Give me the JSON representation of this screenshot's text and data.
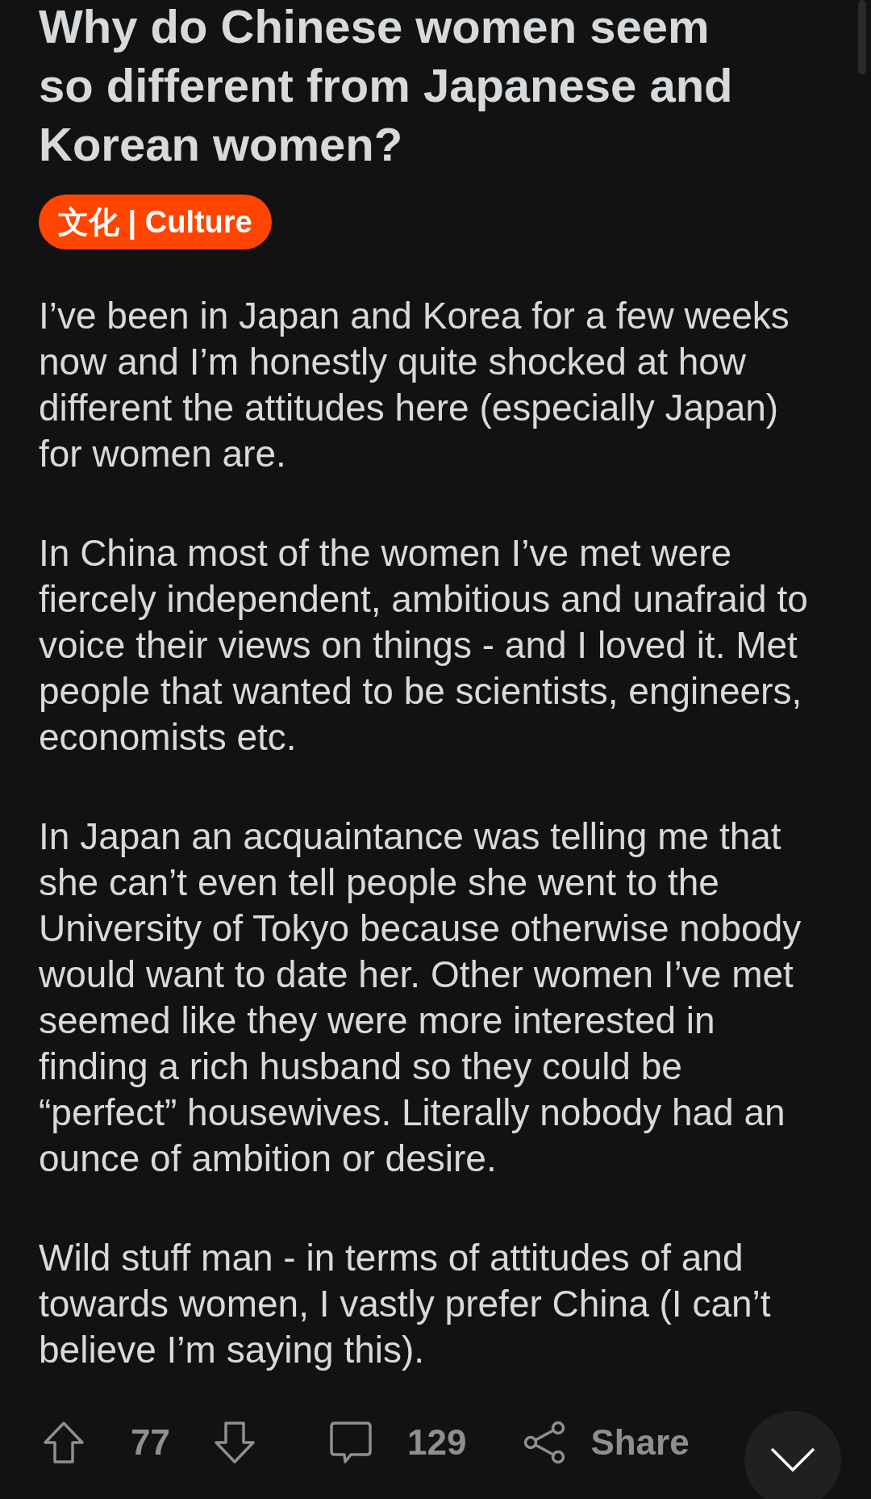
{
  "post": {
    "title": "Why do Chinese women seem so different from Japanese and Korean women?",
    "flair": "文化 | Culture",
    "body": [
      "I’ve been in Japan and Korea for a few weeks now and I’m honestly quite shocked at how different the attitudes here (especially Japan) for women are.",
      "In China most of the women I’ve met were fiercely independent, ambitious and unafraid to voice their views on things - and I loved it. Met people that wanted to be scientists, engineers, economists etc.",
      "In Japan an acquaintance was telling me that she can’t even tell people she went to the University of Tokyo because otherwise nobody would want to date her. Other women I’ve met seemed like they were more interested in finding a rich husband so they could be “perfect” housewives. Literally nobody had an ounce of ambition or desire.",
      "Wild stuff man - in terms of attitudes of and towards women, I vastly prefer China (I can’t believe I’m saying this)."
    ]
  },
  "actions": {
    "score": "77",
    "comments": "129",
    "share": "Share"
  }
}
